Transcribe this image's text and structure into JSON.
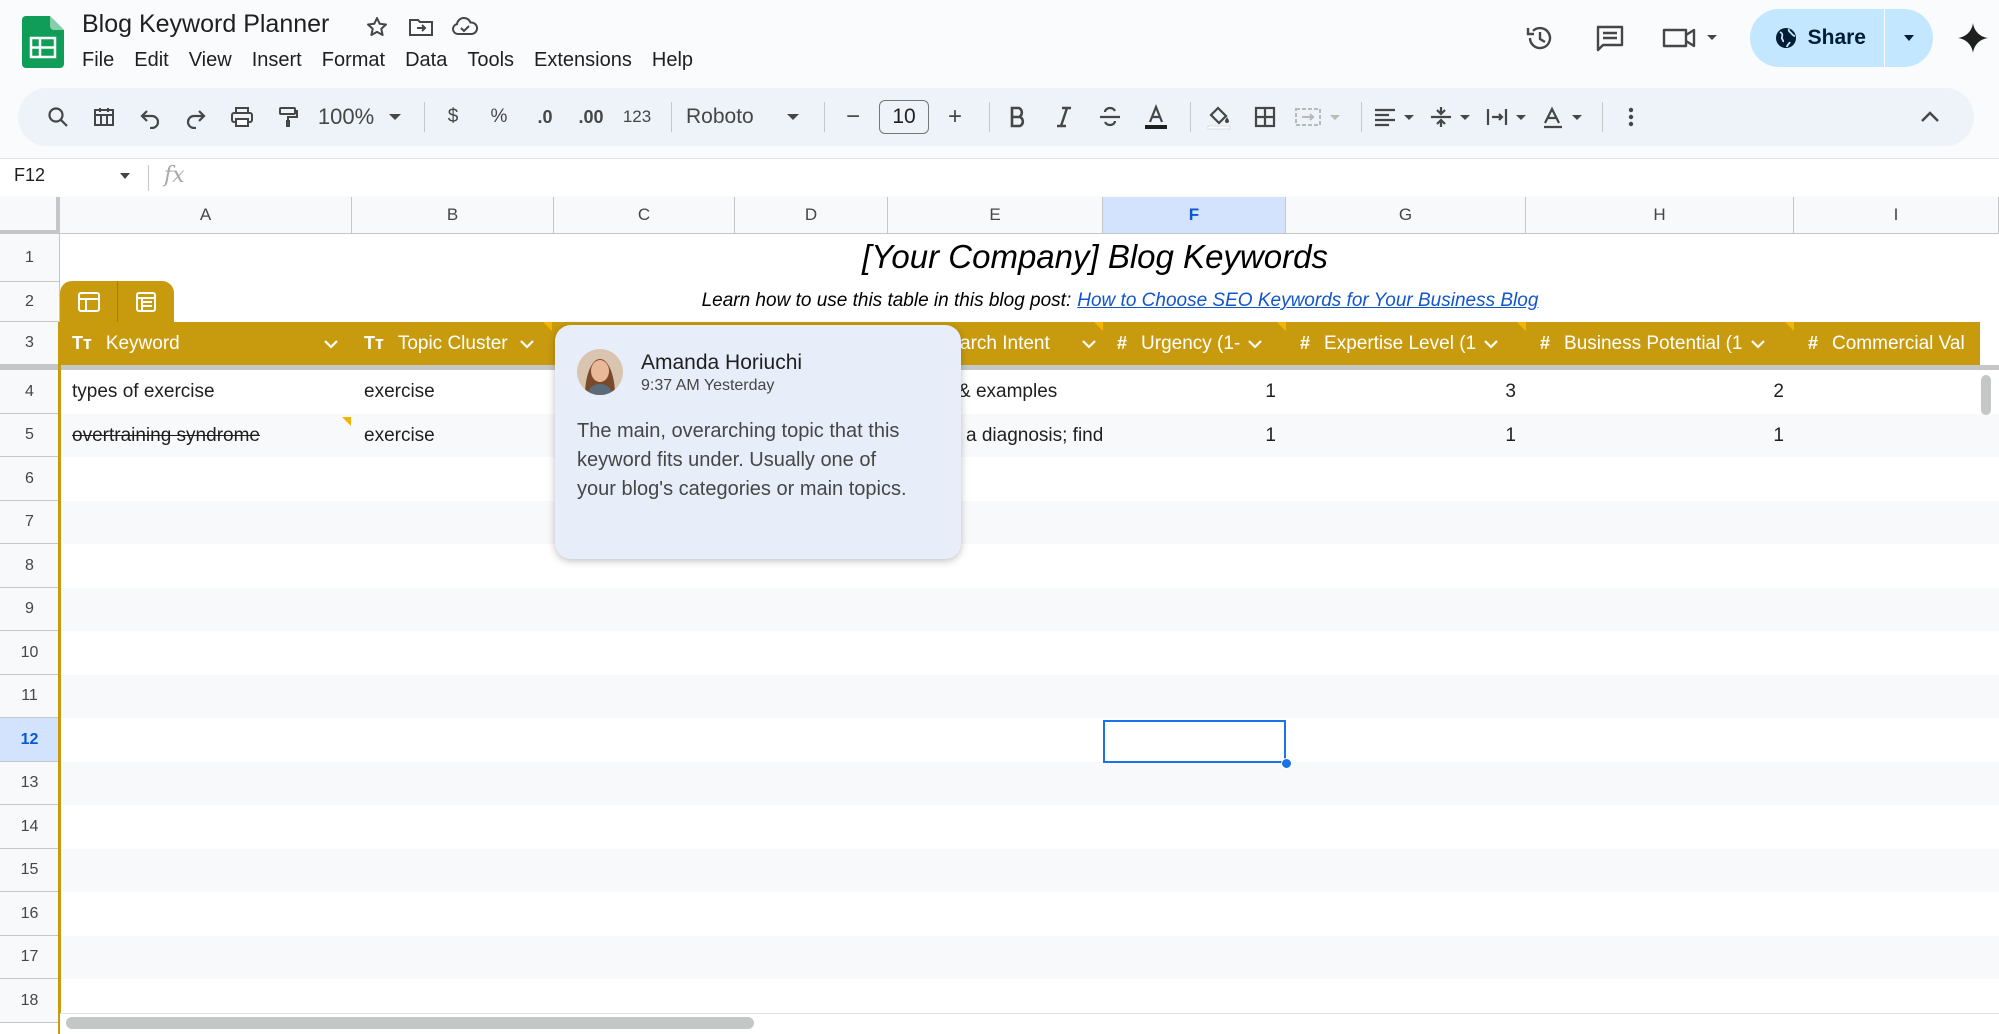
{
  "app": {
    "doc_title": "Blog Keyword Planner",
    "menu": [
      "File",
      "Edit",
      "View",
      "Insert",
      "Format",
      "Data",
      "Tools",
      "Extensions",
      "Help"
    ],
    "share_label": "Share",
    "brand_color": "#0f9d58",
    "accent_color": "#c89b0f"
  },
  "toolbar": {
    "zoom": "100%",
    "currency": "$",
    "percent": "%",
    "dec_decrease": ".0",
    "dec_increase": ".00",
    "number_format": "123",
    "font": "Roboto",
    "font_size": "10",
    "minus": "−",
    "plus": "+"
  },
  "formula_bar": {
    "name_box": "F12",
    "fx": "fx"
  },
  "columns": [
    "A",
    "B",
    "C",
    "D",
    "E",
    "F",
    "G",
    "H",
    "I"
  ],
  "selected_column": "F",
  "rows": [
    "1",
    "2",
    "3",
    "4",
    "5",
    "6",
    "7",
    "8",
    "9",
    "10",
    "11",
    "12",
    "13",
    "14",
    "15",
    "16",
    "17",
    "18"
  ],
  "selected_row": "12",
  "sheet": {
    "title": "[Your Company] Blog Keywords",
    "subtitle_text": "Learn how to use this table in this blog post:",
    "subtitle_link": "How to Choose SEO Keywords for Your Business Blog",
    "headers": {
      "keyword": {
        "type": "Tт",
        "label": "Keyword"
      },
      "topic_cluster": {
        "type": "Tт",
        "label": "Topic Cluster"
      },
      "search_intent": {
        "label": "arch Intent"
      },
      "urgency": {
        "type": "#",
        "label": "Urgency (1-"
      },
      "expertise": {
        "type": "#",
        "label": "Expertise Level (1"
      },
      "business": {
        "type": "#",
        "label": "Business Potential (1"
      },
      "commercial": {
        "type": "#",
        "label": "Commercial Val"
      }
    },
    "data_rows": [
      {
        "keyword": "types of exercise",
        "topic_cluster": "exercise",
        "search_intent": "& examples",
        "urgency": "1",
        "expertise": "3",
        "business": "2"
      },
      {
        "keyword": "overtraining syndrome",
        "topic_cluster": "exercise",
        "search_intent": "a diagnosis; find",
        "urgency": "1",
        "expertise": "1",
        "business": "1"
      }
    ]
  },
  "comment": {
    "author": "Amanda Horiuchi",
    "time": "9:37 AM Yesterday",
    "body": "The main, overarching topic that this keyword fits under. Usually one of your blog's categories or main topics."
  }
}
